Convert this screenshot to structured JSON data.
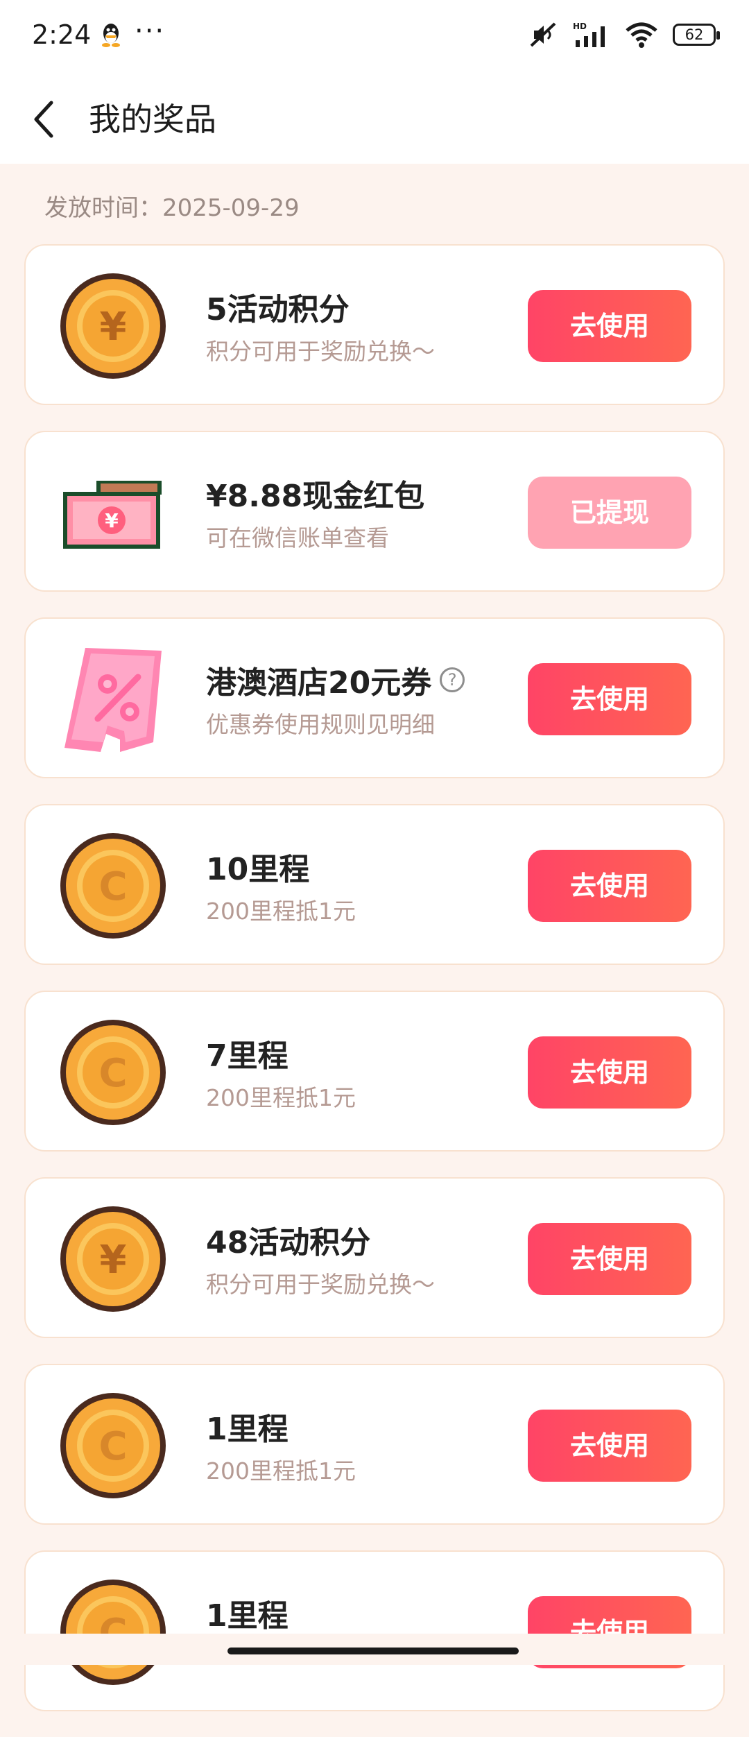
{
  "status_bar": {
    "time": "2:24",
    "icons": [
      "qq-icon",
      "more-dots-icon",
      "mute-icon",
      "hd-signal-icon",
      "wifi-icon",
      "battery-icon"
    ],
    "battery": "62",
    "dots": "···"
  },
  "header": {
    "title": "我的奖品",
    "back_icon": "chevron-left-icon"
  },
  "date_label": "发放时间：2025-09-29",
  "colors": {
    "accent": "#ff4d61",
    "used": "#ffa3b2",
    "background": "#fdf3ee"
  },
  "rewards": [
    {
      "name": "5活动积分",
      "desc": "积分可用于奖励兑换～",
      "button": "去使用",
      "icon": "yuan-coin-icon",
      "state": "active"
    },
    {
      "name": "¥8.88现金红包",
      "desc": "可在微信账单查看",
      "button": "已提现",
      "icon": "cash-bill-icon",
      "state": "used"
    },
    {
      "name": "港澳酒店20元券",
      "desc": "优惠券使用规则见明细",
      "button": "去使用",
      "icon": "coupon-icon",
      "state": "active",
      "help": "?"
    },
    {
      "name": "10里程",
      "desc": "200里程抵1元",
      "button": "去使用",
      "icon": "mileage-coin-icon",
      "state": "active"
    },
    {
      "name": "7里程",
      "desc": "200里程抵1元",
      "button": "去使用",
      "icon": "mileage-coin-icon",
      "state": "active"
    },
    {
      "name": "48活动积分",
      "desc": "积分可用于奖励兑换～",
      "button": "去使用",
      "icon": "yuan-coin-icon",
      "state": "active"
    },
    {
      "name": "1里程",
      "desc": "200里程抵1元",
      "button": "去使用",
      "icon": "mileage-coin-icon",
      "state": "active"
    },
    {
      "name": "1里程",
      "desc": "",
      "button": "去使用",
      "icon": "mileage-coin-icon",
      "state": "active"
    }
  ]
}
